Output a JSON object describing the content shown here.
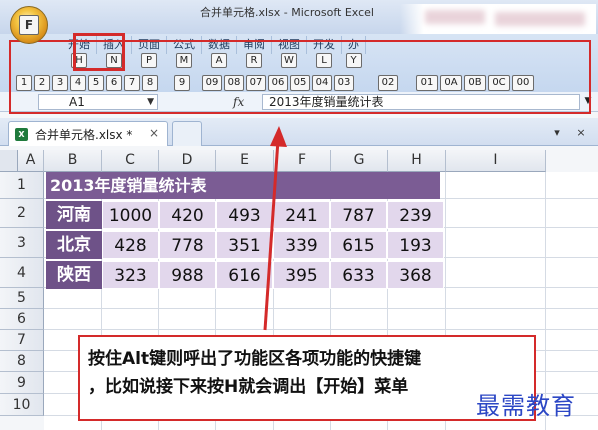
{
  "window": {
    "title": "合并单元格.xlsx - Microsoft Excel"
  },
  "office_button": {
    "key_tip": "F"
  },
  "ribbon": {
    "tabs": [
      {
        "label": "开始",
        "key": "H"
      },
      {
        "label": "插入",
        "key": "N"
      },
      {
        "label": "页面",
        "key": "P"
      },
      {
        "label": "公式",
        "key": "M"
      },
      {
        "label": "数据",
        "key": "A"
      },
      {
        "label": "审阅",
        "key": "R"
      },
      {
        "label": "视图",
        "key": "W"
      },
      {
        "label": "开发",
        "key": "L"
      },
      {
        "label": "办",
        "key": "Y"
      }
    ],
    "quick_access_keys": [
      "1",
      "2",
      "3",
      "4",
      "5",
      "6",
      "7",
      "8",
      "9",
      "09",
      "08",
      "07",
      "06",
      "05",
      "04",
      "03",
      "02",
      "01",
      "0A",
      "0B",
      "0C",
      "00"
    ]
  },
  "formula_bar": {
    "name_box": "A1",
    "fx_label": "fx",
    "value": "2013年度销量统计表"
  },
  "workbook": {
    "tab_label": "合并单元格.xlsx *",
    "close": "×"
  },
  "window_controls": {
    "menu": "▾",
    "close": "×"
  },
  "sheet": {
    "columns": [
      "A",
      "B",
      "C",
      "D",
      "E",
      "F",
      "G",
      "H",
      "I"
    ],
    "rows": [
      "1",
      "2",
      "3",
      "4",
      "5",
      "6",
      "7",
      "8",
      "9",
      "10"
    ],
    "title": "2013年度销量统计表",
    "data": [
      {
        "province": "河南",
        "values": [
          "1000",
          "420",
          "493",
          "241",
          "787",
          "239"
        ]
      },
      {
        "province": "北京",
        "values": [
          "428",
          "778",
          "351",
          "339",
          "615",
          "193"
        ]
      },
      {
        "province": "陕西",
        "values": [
          "323",
          "988",
          "616",
          "395",
          "633",
          "368"
        ]
      }
    ]
  },
  "annotation": {
    "line1": "按住Alt键则呼出了功能区各项功能的快捷键",
    "line2": "，比如说接下来按H就会调出【开始】菜单",
    "watermark": "最需教育"
  },
  "colors": {
    "accent_red": "#d42a2a",
    "header_purple": "#7b5c94",
    "cell_lavender": "#e2d7ec",
    "watermark_blue": "#2c47c5"
  }
}
